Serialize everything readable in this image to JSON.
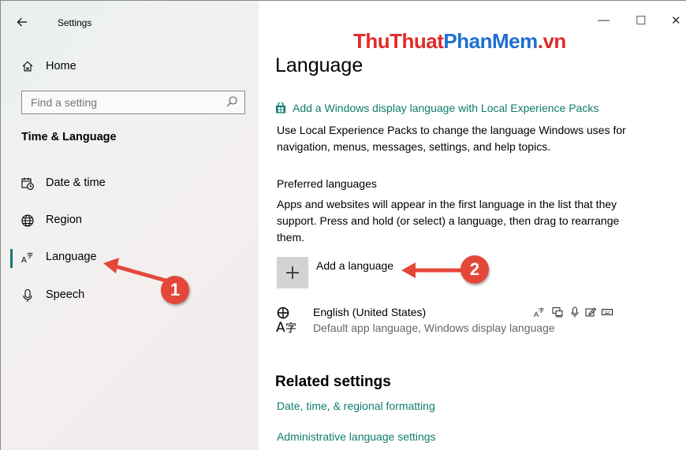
{
  "window": {
    "title": "Settings",
    "controls": {
      "minimize": "—",
      "maximize": "☐",
      "close": "✕"
    }
  },
  "sidebar": {
    "home_label": "Home",
    "search_placeholder": "Find a setting",
    "section_heading": "Time & Language",
    "items": [
      {
        "label": "Date & time",
        "icon": "calendar-clock-icon"
      },
      {
        "label": "Region",
        "icon": "globe-icon"
      },
      {
        "label": "Language",
        "icon": "language-icon",
        "active": true
      },
      {
        "label": "Speech",
        "icon": "microphone-icon"
      }
    ]
  },
  "watermark": {
    "part1": "ThuThuat",
    "part2": "PhanMem",
    "part3": ".vn"
  },
  "main": {
    "title": "Language",
    "lep_link": "Add a Windows display language with Local Experience Packs",
    "lep_desc": "Use Local Experience Packs to change the language Windows uses for navigation, menus, messages, settings, and help topics.",
    "preferred_heading": "Preferred languages",
    "preferred_desc": "Apps and websites will appear in the first language in the list that they support. Press and hold (or select) a language, then drag to rearrange them.",
    "add_language_label": "Add a language",
    "languages": [
      {
        "name": "English (United States)",
        "detail": "Default app language, Windows display language",
        "features": [
          "language-pack-icon",
          "display-icon",
          "speech-icon",
          "handwriting-icon",
          "keyboard-icon"
        ]
      }
    ],
    "related_heading": "Related settings",
    "related_links": [
      "Date, time, & regional formatting",
      "Administrative language settings"
    ]
  },
  "annotations": {
    "badge1": "1",
    "badge2": "2"
  },
  "colors": {
    "accent": "#0e7c6e",
    "annotation": "#e4473a",
    "watermark_red": "#e02b2b",
    "watermark_blue": "#1f6fd1"
  }
}
